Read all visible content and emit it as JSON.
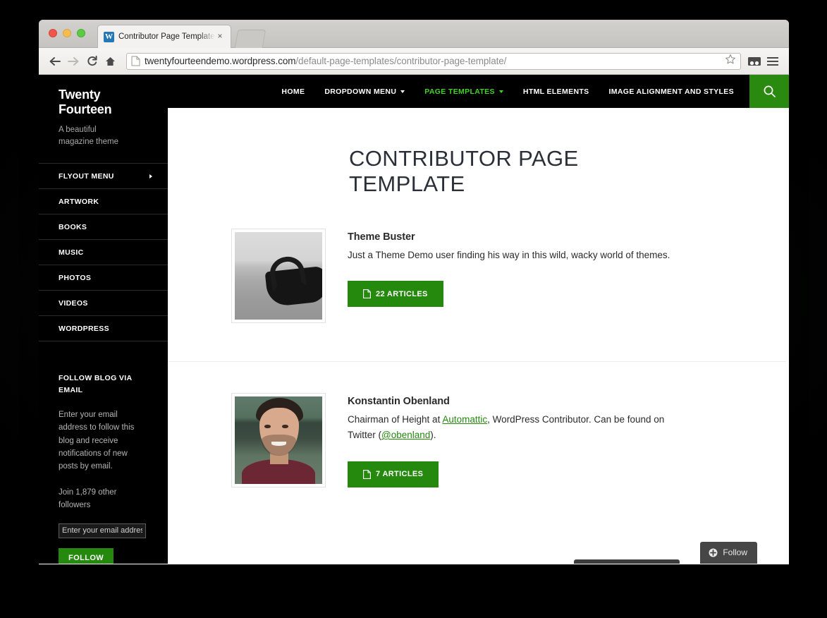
{
  "browser": {
    "tab_title": "Contributor Page Template",
    "tab_close": "×",
    "favicon": "wordpress-favicon",
    "back_icon": "back-arrow-icon",
    "forward_icon": "forward-arrow-icon",
    "reload_icon": "reload-icon",
    "home_icon": "home-icon",
    "url_domain": "twentyfourteendemo.wordpress.com",
    "url_path": "/default-page-templates/contributor-page-template/",
    "star_icon": "bookmark-star-icon",
    "apps_icon": "apps-icon",
    "menu_icon": "hamburger-menu-icon"
  },
  "sidebar": {
    "site_title": "Twenty Fourteen",
    "site_description": "A beautiful magazine theme",
    "items": [
      {
        "label": "FLYOUT MENU",
        "has_flyout": true
      },
      {
        "label": "ARTWORK",
        "has_flyout": false
      },
      {
        "label": "BOOKS",
        "has_flyout": false
      },
      {
        "label": "MUSIC",
        "has_flyout": false
      },
      {
        "label": "PHOTOS",
        "has_flyout": false
      },
      {
        "label": "VIDEOS",
        "has_flyout": false
      },
      {
        "label": "WORDPRESS",
        "has_flyout": false
      }
    ],
    "widget": {
      "title": "FOLLOW BLOG VIA EMAIL",
      "description": "Enter your email address to follow this blog and receive notifications of new posts by email.",
      "followers": "Join 1,879 other followers",
      "input_placeholder": "Enter your email address",
      "input_value": "",
      "button_label": "FOLLOW"
    }
  },
  "topnav": {
    "items": [
      {
        "label": "HOME",
        "active": false,
        "caret": false
      },
      {
        "label": "DROPDOWN MENU",
        "active": false,
        "caret": true
      },
      {
        "label": "PAGE TEMPLATES",
        "active": true,
        "caret": true
      },
      {
        "label": "HTML ELEMENTS",
        "active": false,
        "caret": false
      },
      {
        "label": "IMAGE ALIGNMENT AND STYLES",
        "active": false,
        "caret": false
      }
    ],
    "search_icon": "search-icon"
  },
  "main": {
    "page_title": "CONTRIBUTOR PAGE TEMPLATE",
    "contributors": [
      {
        "name": "Theme Buster",
        "avatar": "sunglasses-on-sand-photo",
        "bio_before": "Just a Theme Demo user finding his way in this wild, wacky world of themes.",
        "links": [],
        "bio_after": "",
        "articles_label": "22 ARTICLES",
        "articles_icon": "document-icon"
      },
      {
        "name": "Konstantin Obenland",
        "avatar": "portrait-photo",
        "bio_before": "Chairman of Height at ",
        "link1": "Automattic",
        "bio_mid": ", WordPress Contributor. Can be found on Twitter (",
        "link2": "@obenland",
        "bio_after": ").",
        "articles_label": "7 ARTICLES",
        "articles_icon": "document-icon"
      }
    ]
  },
  "followbar": {
    "label": "Follow",
    "icon": "plus-circle-icon"
  },
  "colors": {
    "accent_green": "#24890d",
    "nav_active_green": "#41d424",
    "search_button_green": "#2a8a10",
    "sidebar_black": "#000000",
    "title_ink": "#2b3038"
  }
}
